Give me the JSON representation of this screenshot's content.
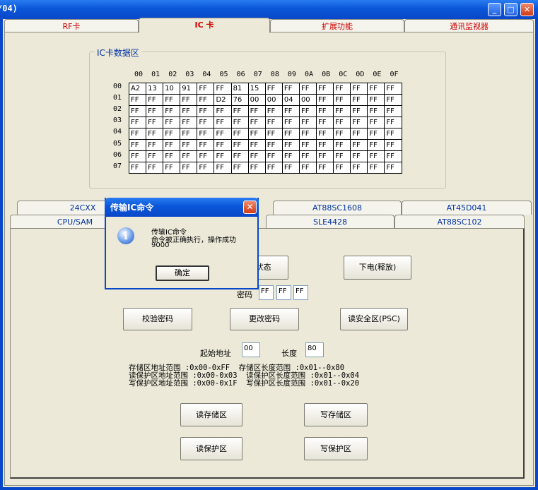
{
  "window": {
    "title": "/04)"
  },
  "top_tabs": [
    "RF卡",
    "IC 卡",
    "扩展功能",
    "通讯监视器"
  ],
  "group": {
    "title": "IC卡数据区",
    "col_headers": [
      "00",
      "01",
      "02",
      "03",
      "04",
      "05",
      "06",
      "07",
      "08",
      "09",
      "0A",
      "0B",
      "0C",
      "0D",
      "0E",
      "0F"
    ],
    "row_labels": [
      "00",
      "01",
      "02",
      "03",
      "04",
      "05",
      "06",
      "07"
    ],
    "rows": [
      [
        "A2",
        "13",
        "10",
        "91",
        "FF",
        "FF",
        "81",
        "15",
        "FF",
        "FF",
        "FF",
        "FF",
        "FF",
        "FF",
        "FF",
        "FF"
      ],
      [
        "FF",
        "FF",
        "FF",
        "FF",
        "FF",
        "D2",
        "76",
        "00",
        "00",
        "04",
        "00",
        "FF",
        "FF",
        "FF",
        "FF",
        "FF"
      ],
      [
        "FF",
        "FF",
        "FF",
        "FF",
        "FF",
        "FF",
        "FF",
        "FF",
        "FF",
        "FF",
        "FF",
        "FF",
        "FF",
        "FF",
        "FF",
        "FF"
      ],
      [
        "FF",
        "FF",
        "FF",
        "FF",
        "FF",
        "FF",
        "FF",
        "FF",
        "FF",
        "FF",
        "FF",
        "FF",
        "FF",
        "FF",
        "FF",
        "FF"
      ],
      [
        "FF",
        "FF",
        "FF",
        "FF",
        "FF",
        "FF",
        "FF",
        "FF",
        "FF",
        "FF",
        "FF",
        "FF",
        "FF",
        "FF",
        "FF",
        "FF"
      ],
      [
        "FF",
        "FF",
        "FF",
        "FF",
        "FF",
        "FF",
        "FF",
        "FF",
        "FF",
        "FF",
        "FF",
        "FF",
        "FF",
        "FF",
        "FF",
        "FF"
      ],
      [
        "FF",
        "FF",
        "FF",
        "FF",
        "FF",
        "FF",
        "FF",
        "FF",
        "FF",
        "FF",
        "FF",
        "FF",
        "FF",
        "FF",
        "FF",
        "FF"
      ],
      [
        "FF",
        "FF",
        "FF",
        "FF",
        "FF",
        "FF",
        "FF",
        "FF",
        "FF",
        "FF",
        "FF",
        "FF",
        "FF",
        "FF",
        "FF",
        "FF"
      ]
    ]
  },
  "sub_tabs_row1": [
    "24CXX",
    "AT88SC1608",
    "AT45D041"
  ],
  "sub_tabs_row2": [
    "CPU/SAM",
    "SLE4428",
    "AT88SC102"
  ],
  "controls": {
    "card_status": "卡状态",
    "power_off": "下电(释放)",
    "password_label": "密码",
    "password": [
      "FF",
      "FF",
      "FF"
    ],
    "verify_pwd": "校验密码",
    "change_pwd": "更改密码",
    "read_psc": "读安全区(PSC)",
    "start_addr_label": "起始地址",
    "start_addr": "00",
    "length_label": "长度",
    "length": "80",
    "info_line1": "存储区地址范围 :0x00-0xFF  存储区长度范围 :0x01--0x80",
    "info_line2": "读保护区地址范围 :0x00-0x03  读保护区长度范围 :0x01--0x04",
    "info_line3": "写保护区地址范围 :0x00-0x1F  写保护区长度范围 :0x01--0x20",
    "read_mem": "读存储区",
    "write_mem": "写存储区",
    "read_prot": "读保护区",
    "write_prot": "写保护区"
  },
  "dialog": {
    "title": "传输IC命令",
    "line1": "传输IC命令",
    "line2": "命令被正确执行，操作成功",
    "line3": "9000",
    "ok": "确定"
  }
}
